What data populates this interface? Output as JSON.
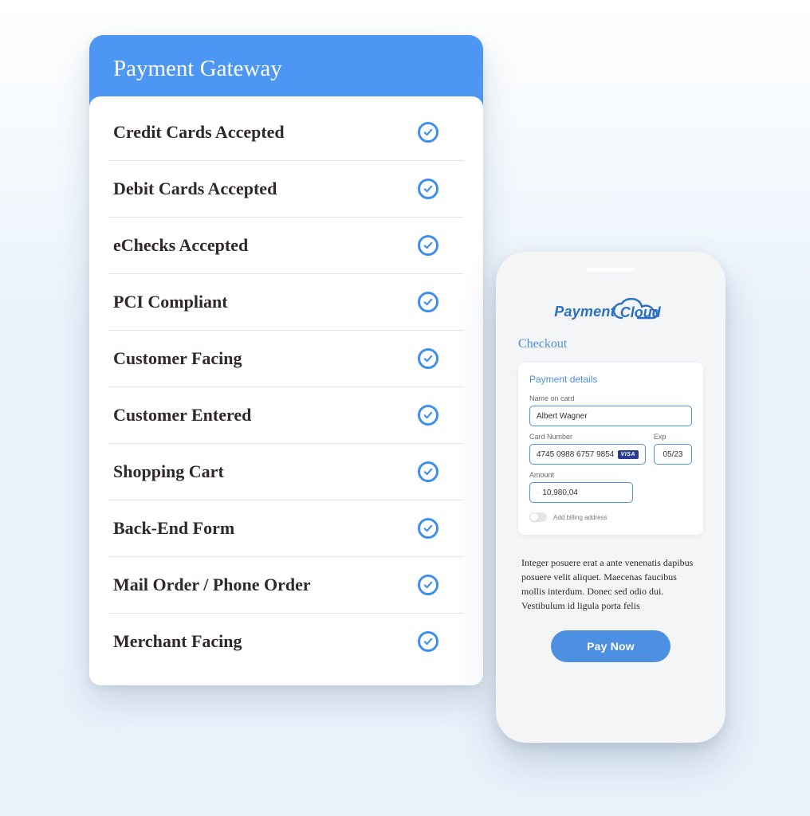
{
  "card": {
    "title": "Payment Gateway",
    "items": [
      {
        "label": "Credit Cards Accepted",
        "checked": true
      },
      {
        "label": "Debit Cards Accepted",
        "checked": true
      },
      {
        "label": "eChecks Accepted",
        "checked": true
      },
      {
        "label": "PCI Compliant",
        "checked": true
      },
      {
        "label": "Customer Facing",
        "checked": true
      },
      {
        "label": "Customer Entered",
        "checked": true
      },
      {
        "label": "Shopping Cart",
        "checked": true
      },
      {
        "label": "Back-End Form",
        "checked": true
      },
      {
        "label": "Mail Order / Phone Order",
        "checked": true
      },
      {
        "label": "Merchant Facing",
        "checked": true
      }
    ]
  },
  "phone": {
    "brand": {
      "part1": "Payment",
      "part2": "Cloud"
    },
    "checkout_title": "Checkout",
    "details_title": "Payment details",
    "fields": {
      "name_label": "Name on card",
      "name_value": "Albert Wagner",
      "card_label": "Card Number",
      "card_value": "4745 0988 6757 9854",
      "card_brand": "VISA",
      "exp_label": "Exp",
      "exp_value": "05/23",
      "amount_label": "Amount",
      "amount_value": "10,980,04"
    },
    "toggle_label": "Add billing address",
    "toggle_on": false,
    "lorem": "Integer posuere erat a ante venenatis dapibus posuere velit aliquet. Maecenas faucibus mollis interdum. Donec sed odio dui. Vestibulum id ligula porta felis",
    "pay_button": "Pay Now"
  },
  "colors": {
    "accent": "#4d8fe0",
    "header": "#4d96f3"
  }
}
